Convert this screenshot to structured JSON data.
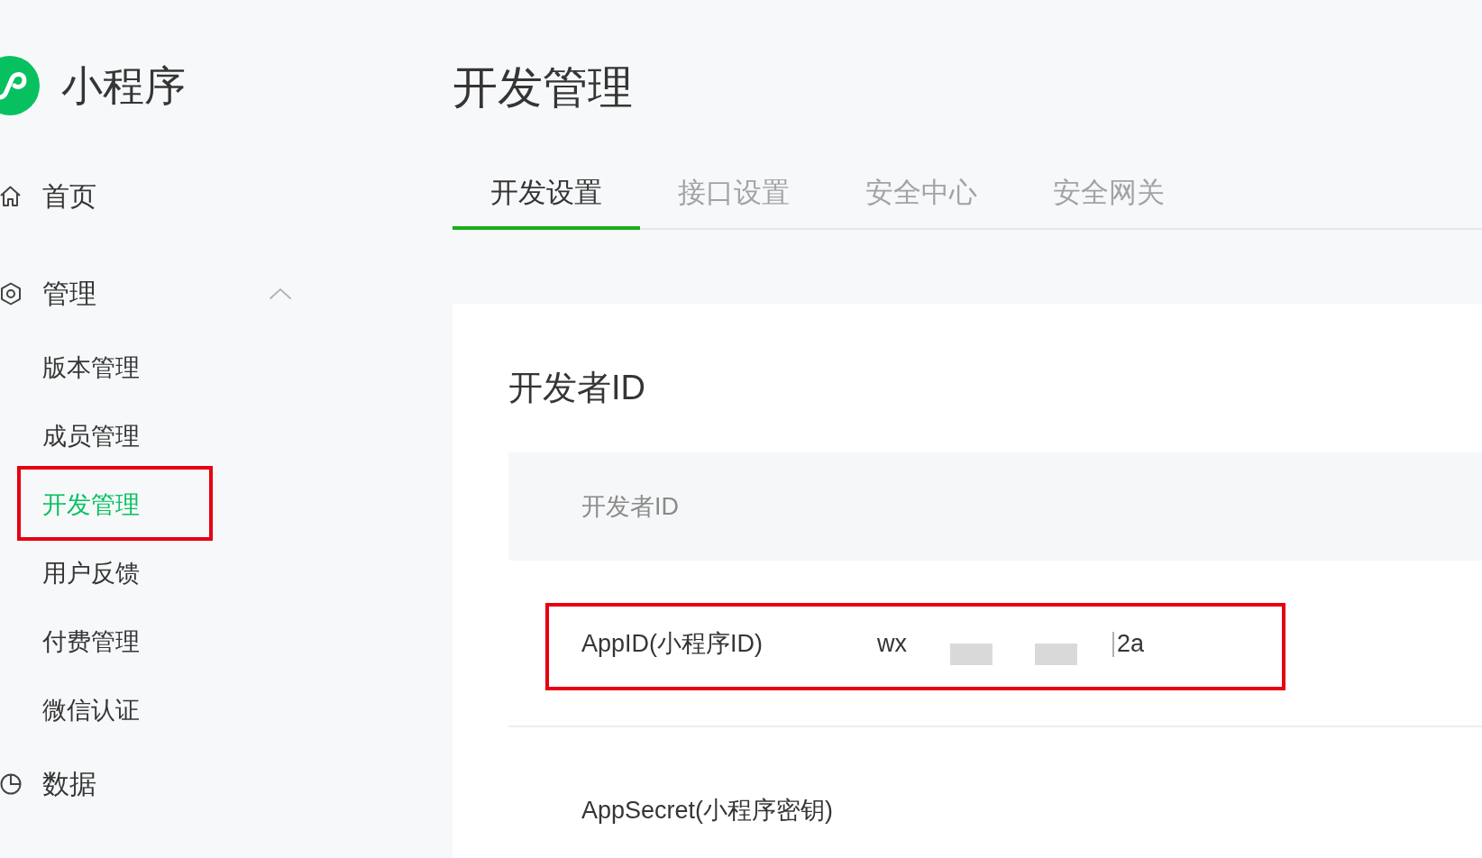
{
  "app": {
    "name": "小程序"
  },
  "sidebar": {
    "items": [
      {
        "kind": "link",
        "label": "首页"
      },
      {
        "kind": "group",
        "label": "管理",
        "expanded": true,
        "children": [
          {
            "label": "版本管理",
            "selected": false,
            "highlighted": false
          },
          {
            "label": "成员管理",
            "selected": false,
            "highlighted": false
          },
          {
            "label": "开发管理",
            "selected": true,
            "highlighted": true
          },
          {
            "label": "用户反馈",
            "selected": false,
            "highlighted": false
          },
          {
            "label": "付费管理",
            "selected": false,
            "highlighted": false
          },
          {
            "label": "微信认证",
            "selected": false,
            "highlighted": false
          }
        ]
      },
      {
        "kind": "link",
        "label": "数据"
      }
    ]
  },
  "page": {
    "title": "开发管理"
  },
  "tabs": [
    {
      "label": "开发设置",
      "selected": true
    },
    {
      "label": "接口设置",
      "selected": false
    },
    {
      "label": "安全中心",
      "selected": false
    },
    {
      "label": "安全网关",
      "selected": false
    }
  ],
  "card": {
    "heading": "开发者ID",
    "table_header": "开发者ID",
    "rows": [
      {
        "label": "AppID(小程序ID)",
        "value_start": "wx",
        "value_end": "2a",
        "masked": true,
        "highlighted": true
      },
      {
        "label": "AppSecret(小程序密钥)",
        "highlighted": false
      }
    ]
  }
}
